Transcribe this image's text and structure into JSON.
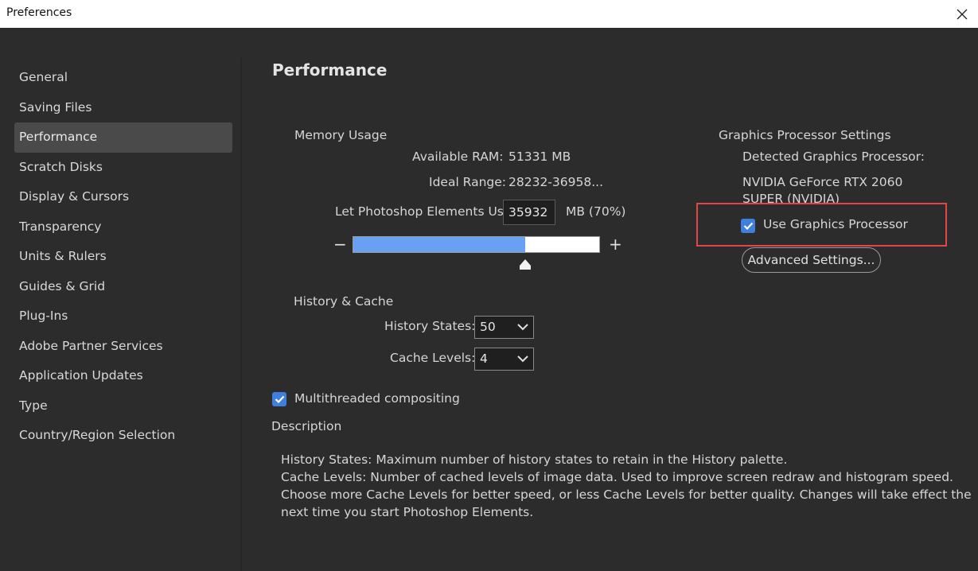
{
  "window": {
    "title": "Preferences"
  },
  "sidebar": {
    "items": [
      {
        "label": "General"
      },
      {
        "label": "Saving Files"
      },
      {
        "label": "Performance",
        "active": true
      },
      {
        "label": "Scratch Disks"
      },
      {
        "label": "Display & Cursors"
      },
      {
        "label": "Transparency"
      },
      {
        "label": "Units & Rulers"
      },
      {
        "label": "Guides & Grid"
      },
      {
        "label": "Plug-Ins"
      },
      {
        "label": "Adobe Partner Services"
      },
      {
        "label": "Application Updates"
      },
      {
        "label": "Type"
      },
      {
        "label": "Country/Region Selection"
      }
    ]
  },
  "main": {
    "heading": "Performance",
    "memory": {
      "section_label": "Memory Usage",
      "available_label": "Available RAM:",
      "available_value": "51331 MB",
      "ideal_label": "Ideal Range:",
      "ideal_value": "28232-36958...",
      "let_use_label": "Let Photoshop Elements Use:",
      "let_use_value": "35932",
      "let_use_unit": "MB (70%)",
      "minus": "−",
      "plus": "+",
      "slider_fraction": 0.7
    },
    "history": {
      "section_label": "History & Cache",
      "states_label": "History States:",
      "states_value": "50",
      "cache_label": "Cache Levels:",
      "cache_value": "4"
    },
    "multithreaded": {
      "label": "Multithreaded compositing",
      "checked": true
    },
    "gpu": {
      "section_label": "Graphics Processor Settings",
      "detected_label": "Detected Graphics Processor:",
      "detected_line1": "NVIDIA GeForce RTX 2060",
      "detected_line2": "SUPER (NVIDIA)",
      "use_gpu_label": "Use Graphics Processor",
      "use_gpu_checked": true,
      "advanced_button": "Advanced Settings..."
    },
    "description": {
      "label": "Description",
      "lines": [
        "History States: Maximum number of history states to retain in the History palette.",
        "Cache Levels: Number of cached levels of image data.  Used to improve screen redraw and histogram speed.",
        "Choose more Cache Levels for better speed, or less Cache Levels for better quality. Changes will take effect the",
        "next time you start Photoshop Elements."
      ]
    }
  },
  "colors": {
    "accent": "#3f7fe0",
    "slider_fill": "#6aa0f3",
    "highlight": "#e04848"
  },
  "icons": {
    "close": "close-icon",
    "checkbox": "checkmark-icon",
    "select": "chevron-down-icon",
    "slider": "slider-thumb-icon"
  }
}
